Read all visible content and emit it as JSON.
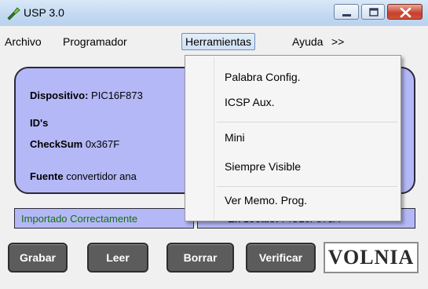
{
  "window": {
    "title": "USP 3.0"
  },
  "menubar": {
    "items": [
      "Archivo",
      "Programador",
      "Herramientas",
      "Ayuda",
      ">>"
    ],
    "active": "Herramientas"
  },
  "device": {
    "dispositivo_label": "Dispositivo:",
    "dispositivo_value": "PIC16F873",
    "ids_label": "ID's",
    "checksum_label": "CheckSum",
    "checksum_value": "0x367F",
    "fuente_label": "Fuente",
    "fuente_value": "convertidor ana"
  },
  "status": {
    "import_text": "Importado Correctamente",
    "socket_label": "En zocalo:",
    "socket_value": "PIC16F873A"
  },
  "buttons": {
    "grabar": "Grabar",
    "leer": "Leer",
    "borrar": "Borrar",
    "verificar": "Verificar"
  },
  "logo": {
    "text_a": "VOL",
    "text_b": "NIA"
  },
  "dropdown": {
    "items": [
      "Palabra Config.",
      "ICSP Aux.",
      "Mini",
      "Siempre Visible",
      "Ver Memo. Prog."
    ]
  },
  "colors": {
    "panel": "#b5b8f7",
    "status_text": "#107010",
    "button": "#5c5c5c"
  }
}
